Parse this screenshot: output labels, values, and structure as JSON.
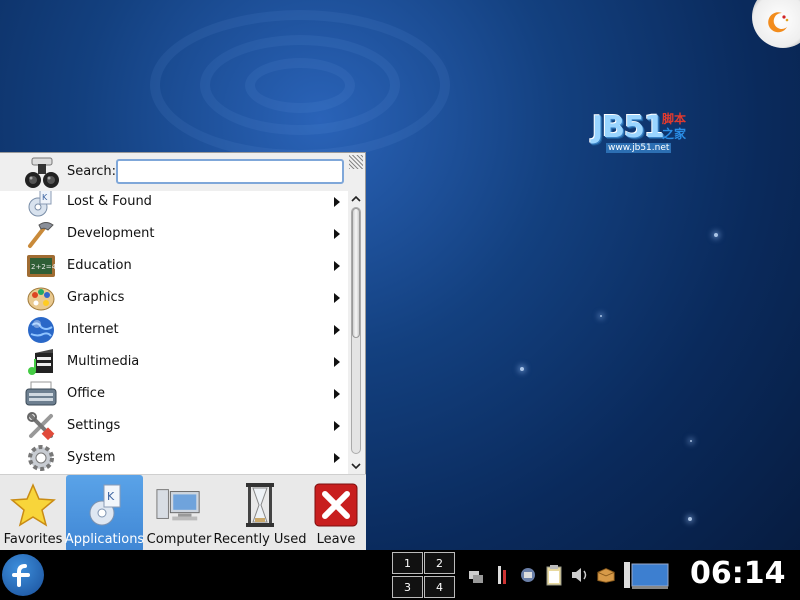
{
  "colors": {
    "accent": "#4a94de",
    "desktop": "#13407f",
    "taskbar": "#000000"
  },
  "watermark": {
    "big": "JB51",
    "cn1": "脚本",
    "cn2": "之家",
    "url": "www.jb51.net"
  },
  "menu": {
    "search_label": "Search:",
    "search_value": "",
    "items": [
      {
        "label": "Lost & Found",
        "icon": "lost-found-icon"
      },
      {
        "label": "Development",
        "icon": "development-icon"
      },
      {
        "label": "Education",
        "icon": "education-icon"
      },
      {
        "label": "Graphics",
        "icon": "graphics-icon"
      },
      {
        "label": "Internet",
        "icon": "internet-icon"
      },
      {
        "label": "Multimedia",
        "icon": "multimedia-icon"
      },
      {
        "label": "Office",
        "icon": "office-icon"
      },
      {
        "label": "Settings",
        "icon": "settings-icon"
      },
      {
        "label": "System",
        "icon": "system-icon"
      }
    ],
    "tabs": [
      {
        "label": "Favorites",
        "active": false
      },
      {
        "label": "Applications",
        "active": true
      },
      {
        "label": "Computer",
        "active": false
      },
      {
        "label": "Recently Used",
        "active": false
      },
      {
        "label": "Leave",
        "active": false
      }
    ]
  },
  "taskbar": {
    "pager": [
      "1",
      "2",
      "3",
      "4"
    ],
    "clock": "06:14"
  }
}
